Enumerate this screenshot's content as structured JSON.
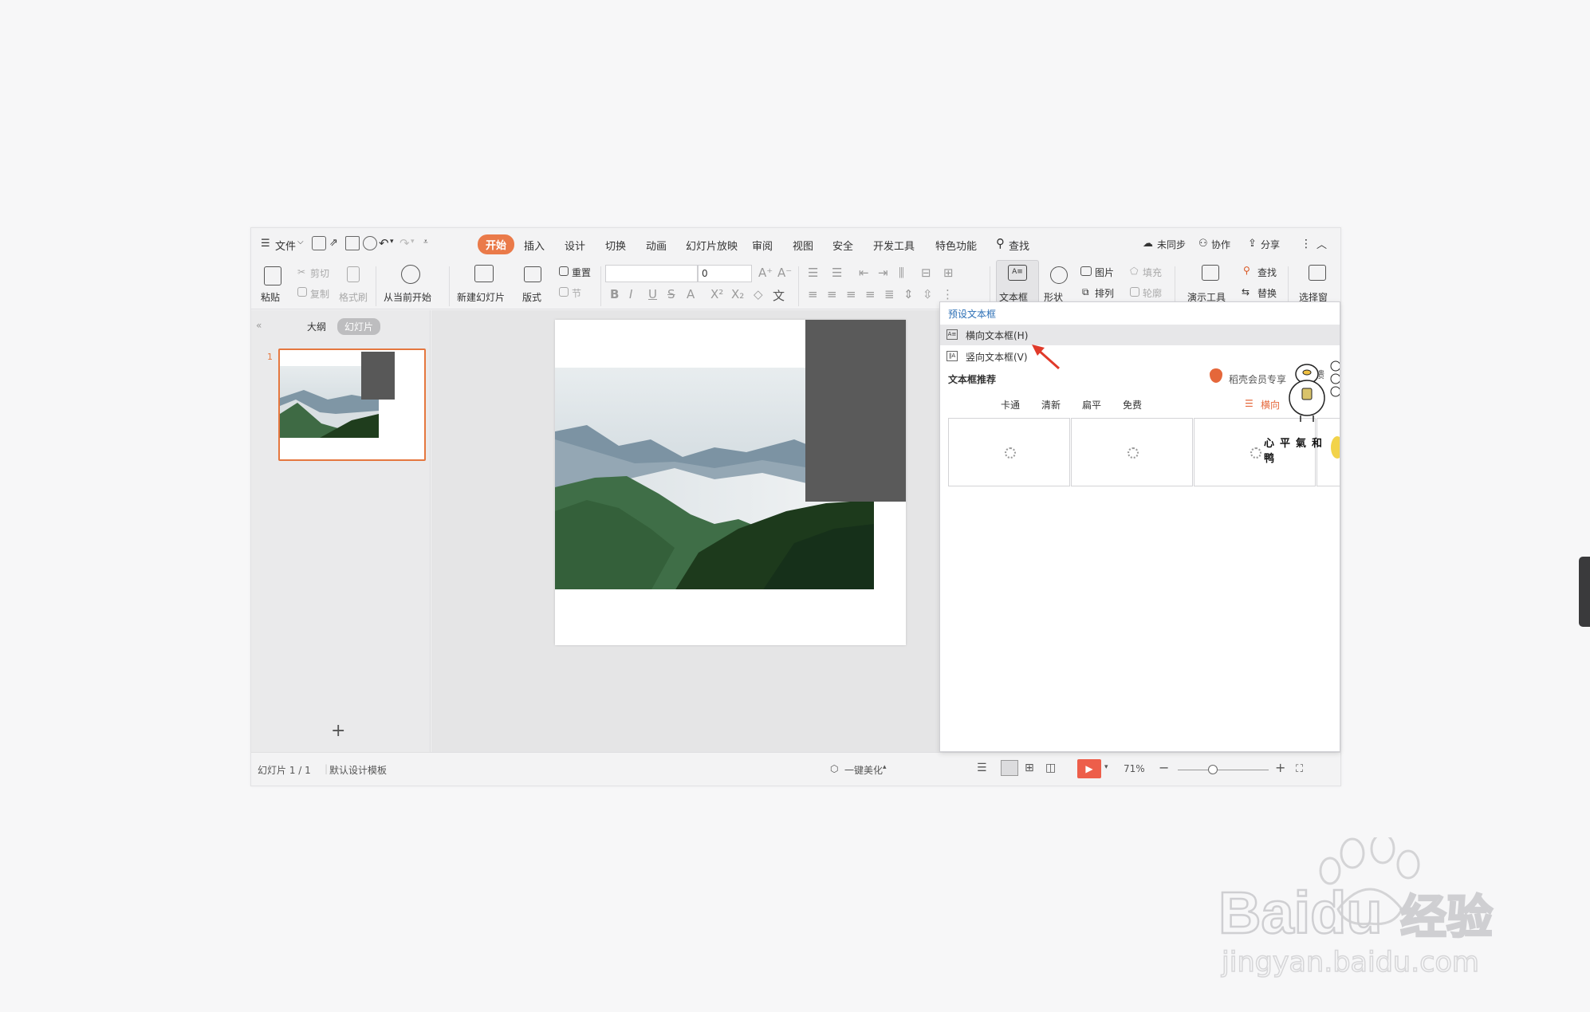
{
  "menu": {
    "file": "文件",
    "tabs": [
      "开始",
      "插入",
      "设计",
      "切换",
      "动画",
      "幻灯片放映",
      "审阅",
      "视图",
      "安全",
      "开发工具",
      "特色功能"
    ],
    "active_tab": "开始",
    "search": "查找",
    "sync": "未同步",
    "collab": "协作",
    "share": "分享"
  },
  "ribbon": {
    "paste": "粘贴",
    "cut": "剪切",
    "copy": "复制",
    "format_painter": "格式刷",
    "from_current": "从当前开始",
    "new_slide": "新建幻灯片",
    "layout": "版式",
    "reset": "重置",
    "section": "节",
    "font_size": "0",
    "text_box": "文本框",
    "shape": "形状",
    "picture": "图片",
    "fill": "填充",
    "arrange": "排列",
    "outline": "轮廓",
    "presentation_tools": "演示工具",
    "find": "查找",
    "replace": "替换",
    "select_pane": "选择窗"
  },
  "left_panel": {
    "outline_tab": "大纲",
    "slides_tab": "幻灯片",
    "slide_number": "1"
  },
  "status": {
    "slide_count": "幻灯片 1 / 1",
    "template": "默认设计模板",
    "beautify": "一键美化",
    "zoom": "71%"
  },
  "dropdown": {
    "preset_header": "预设文本框",
    "horizontal": "横向文本框(H)",
    "vertical": "竖向文本框(V)",
    "recommend_header": "文本框推荐",
    "member": "稻壳会员专享",
    "feedback": "反馈",
    "filters": [
      "卡通",
      "清新",
      "扁平",
      "免费"
    ],
    "orientation_filter": "横向"
  },
  "sticker_text": "心平氣和鸭",
  "watermark": {
    "brand": "Baidu",
    "cn": "经验",
    "url": "jingyan.baidu.com"
  },
  "colors": {
    "accent": "#ea7a49",
    "play": "#ed5e4a",
    "member_badge": "#e5673a"
  }
}
